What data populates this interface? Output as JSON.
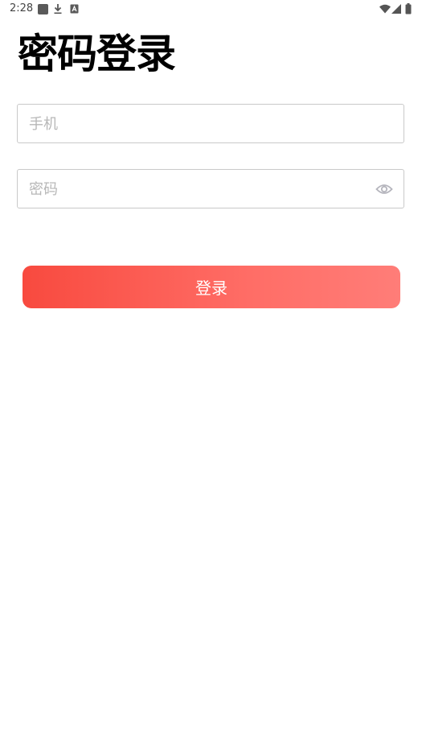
{
  "status_bar": {
    "time": "2:28",
    "icons": [
      "notification-square-icon",
      "download-icon",
      "a-badge-icon",
      "wifi-icon",
      "signal-icon",
      "battery-icon"
    ]
  },
  "page": {
    "title": "密码登录"
  },
  "form": {
    "phone_placeholder": "手机",
    "phone_value": "",
    "password_placeholder": "密码",
    "password_value": "",
    "toggle_icon": "eye-icon",
    "submit_label": "登录"
  },
  "colors": {
    "button_gradient_start": "#f84a3f",
    "button_gradient_end": "#ff7d78",
    "placeholder": "#b7b7b7",
    "border": "#c9c9c9"
  }
}
